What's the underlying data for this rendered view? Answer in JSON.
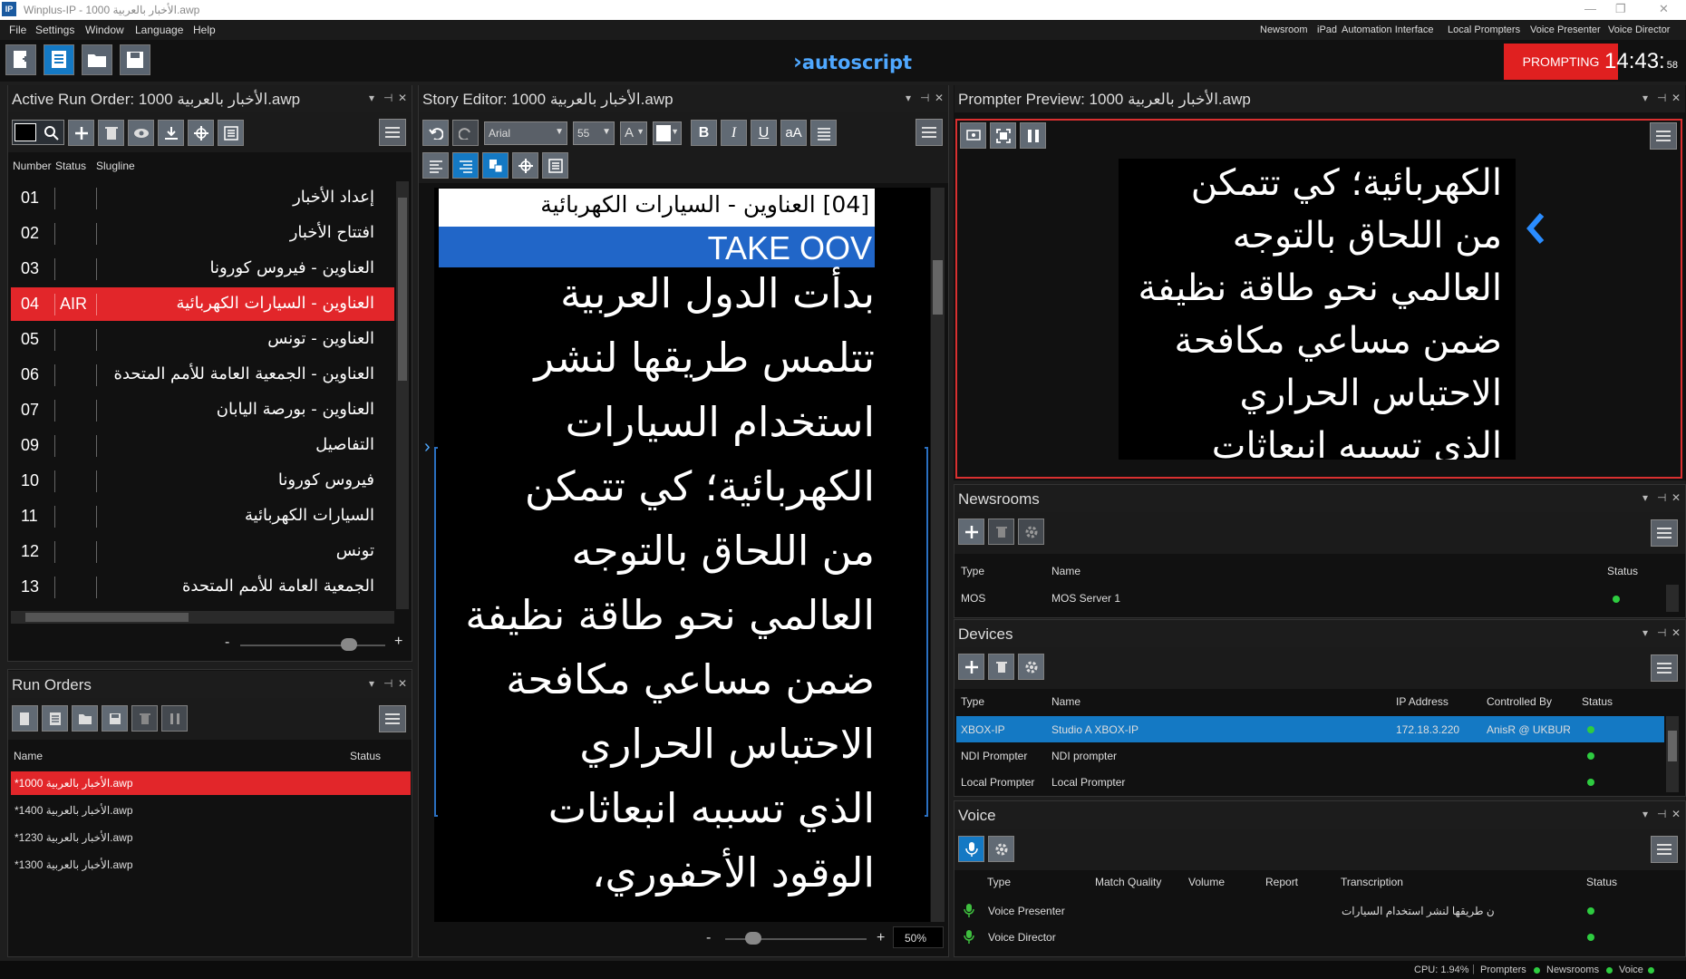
{
  "window": {
    "title": "Winplus-IP - 1000 الأخبار بالعربية.awp",
    "app_icon": "IP"
  },
  "menu": {
    "items": [
      "File",
      "Settings",
      "Window",
      "Language",
      "Help"
    ],
    "right_items": [
      "Newsroom",
      "iPad",
      "Automation Interface",
      "Local Prompters",
      "Voice Presenter",
      "Voice Director"
    ]
  },
  "toolbar": {
    "logo": "autoscript",
    "prompting_label": "PROMPTING",
    "clock": "14:43:",
    "clock_seconds": "58"
  },
  "run_order": {
    "title": "Active Run Order: 1000 الأخبار بالعربية.awp",
    "col_number": "Number",
    "col_status": "Status",
    "col_slugline": "Slugline",
    "rows": [
      {
        "number": "01",
        "status": "",
        "slug": "إعداد الأخبار"
      },
      {
        "number": "02",
        "status": "",
        "slug": "افتتاح الأخبار"
      },
      {
        "number": "03",
        "status": "",
        "slug": "العناوين - فيروس كورونا"
      },
      {
        "number": "04",
        "status": "AIR",
        "slug": "العناوين - السيارات الكهربائية"
      },
      {
        "number": "05",
        "status": "",
        "slug": "العناوين - تونس"
      },
      {
        "number": "06",
        "status": "",
        "slug": "العناوين - الجمعية العامة للأمم المتحدة"
      },
      {
        "number": "07",
        "status": "",
        "slug": "العناوين - بورصة اليابان"
      },
      {
        "number": "09",
        "status": "",
        "slug": "التفاصيل"
      },
      {
        "number": "10",
        "status": "",
        "slug": "فيروس كورونا"
      },
      {
        "number": "11",
        "status": "",
        "slug": "السيارات الكهربائية"
      },
      {
        "number": "12",
        "status": "",
        "slug": "تونس"
      },
      {
        "number": "13",
        "status": "",
        "slug": "الجمعية العامة للأمم المتحدة"
      }
    ],
    "zoom_minus": "-",
    "zoom_plus": "+",
    "zoom_level": 0.75
  },
  "run_orders": {
    "title": "Run Orders",
    "col_name": "Name",
    "col_status": "Status",
    "items": [
      "*1000 الأخبار بالعربية.awp",
      "*1400 الأخبار بالعربية.awp",
      "*1230 الأخبار بالعربية.awp",
      "*1300 الأخبار بالعربية.awp"
    ]
  },
  "story_editor": {
    "title": "Story Editor: 1000 الأخبار بالعربية.awp",
    "font": "Arial",
    "font_size": "55",
    "font_color_label": "A",
    "bold": "B",
    "italic": "I",
    "underline": "U",
    "case": "aA",
    "story_header": "[04]  العناوين - السيارات الكهربائية",
    "take_label": "TAKE OOV",
    "lines": [
      "بدأت الدول العربية",
      "تتلمس طريقها لنشر",
      "استخدام السيارات",
      "الكهربائية؛ كي تتمكن",
      "من اللحاق بالتوجه",
      "العالمي نحو طاقة نظيفة",
      "ضمن مساعي مكافحة",
      "الاحتباس الحراري",
      "الذي تسببه انبعاثات",
      "الوقود الأحفوري،"
    ],
    "zoom_minus": "-",
    "zoom_plus": "+",
    "zoom_percent": "50%",
    "zoom_level": 0.2
  },
  "preview": {
    "title": "Prompter Preview: 1000 الأخبار بالعربية.awp",
    "lines": [
      "الكهربائية؛ كي تتمكن",
      "من اللحاق بالتوجه",
      "العالمي نحو طاقة نظيفة",
      "ضمن مساعي مكافحة",
      "الاحتباس الحراري",
      "الذي تسببه انبعاثات"
    ]
  },
  "newsrooms": {
    "title": "Newsrooms",
    "col_type": "Type",
    "col_name": "Name",
    "col_status": "Status",
    "rows": [
      {
        "type": "MOS",
        "name": "MOS Server 1"
      }
    ]
  },
  "devices": {
    "title": "Devices",
    "col_type": "Type",
    "col_name": "Name",
    "col_ip": "IP Address",
    "col_controlled": "Controlled By",
    "col_status": "Status",
    "rows": [
      {
        "type": "XBOX-IP",
        "name": "Studio A XBOX-IP",
        "ip": "172.18.3.220",
        "controlled": "AnisR @ UKBUR-F"
      },
      {
        "type": "NDI Prompter",
        "name": "NDI prompter",
        "ip": "",
        "controlled": ""
      },
      {
        "type": "Local Prompter",
        "name": "Local Prompter",
        "ip": "",
        "controlled": ""
      }
    ]
  },
  "voice": {
    "title": "Voice",
    "col_type": "Type",
    "col_match": "Match Quality",
    "col_volume": "Volume",
    "col_report": "Report",
    "col_transcription": "Transcription",
    "col_status": "Status",
    "rows": [
      {
        "type": "Voice Presenter",
        "transcription": "ن طريقها لنشر استخدام السيارات"
      },
      {
        "type": "Voice Director",
        "transcription": ""
      }
    ]
  },
  "statusbar": {
    "cpu": "CPU: 1.94%",
    "prompters": "Prompters",
    "newsrooms": "Newsrooms",
    "voice": "Voice"
  },
  "colors": {
    "accent_red": "#e2262a",
    "accent_blue": "#1479c4",
    "status_green": "#2ecc40"
  }
}
